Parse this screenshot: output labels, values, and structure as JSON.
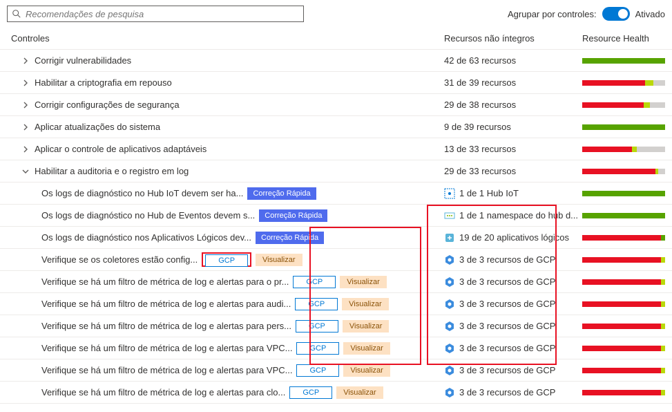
{
  "search": {
    "placeholder": "Recomendações de pesquisa"
  },
  "groupBy": {
    "label": "Agrupar por controles:",
    "state": "Ativado"
  },
  "columns": {
    "controls": "Controles",
    "unhealthy": "Recursos não íntegros",
    "health": "Resource Health"
  },
  "badges": {
    "quickfix": "Correção Rápida",
    "gcp": "GCP",
    "preview": "Visualizar"
  },
  "controls": [
    {
      "title": "Corrigir vulnerabilidades",
      "resources": "42 de 63 recursos",
      "health": [
        [
          "green",
          100
        ]
      ]
    },
    {
      "title": "Habilitar a criptografia em repouso",
      "resources": "31 de 39 recursos",
      "health": [
        [
          "red",
          76
        ],
        [
          "lime",
          10
        ],
        [
          "gray",
          14
        ]
      ]
    },
    {
      "title": "Corrigir configurações de segurança",
      "resources": "29 de 38 recursos",
      "health": [
        [
          "red",
          74
        ],
        [
          "lime",
          8
        ],
        [
          "gray",
          18
        ]
      ]
    },
    {
      "title": "Aplicar atualizações do sistema",
      "resources": "9 de 39 recursos",
      "health": [
        [
          "green",
          100
        ]
      ]
    },
    {
      "title": "Aplicar o controle de aplicativos adaptáveis",
      "resources": "13 de 33 recursos",
      "health": [
        [
          "red",
          60
        ],
        [
          "lime",
          6
        ],
        [
          "gray",
          34
        ]
      ]
    },
    {
      "title": "Habilitar a auditoria e o registro em log",
      "resources": "29 de 33 recursos",
      "health": [
        [
          "red",
          88
        ],
        [
          "lime",
          4
        ],
        [
          "gray",
          8
        ]
      ],
      "expanded": true
    }
  ],
  "children": [
    {
      "title": "Os logs de diagnóstico no Hub IoT devem ser ha...",
      "quickfix": true,
      "resIcon": "iot",
      "resources": "1 de 1 Hub IoT",
      "health": [
        [
          "green",
          100
        ]
      ]
    },
    {
      "title": "Os logs de diagnóstico no Hub de Eventos devem s...",
      "quickfix": true,
      "resIcon": "eventhub",
      "resources": "1 de 1 namespace do hub d...",
      "health": [
        [
          "green",
          100
        ]
      ]
    },
    {
      "title": "Os logs de diagnóstico nos Aplicativos Lógicos dev...",
      "quickfix": true,
      "resIcon": "logicapp",
      "resources": "19 de 20 aplicativos lógicos",
      "health": [
        [
          "red",
          95
        ],
        [
          "green",
          5
        ]
      ]
    },
    {
      "title": "Verifique se os coletores estão config...",
      "gcp": true,
      "preview": true,
      "resIcon": "gcp",
      "resources": "3 de 3 recursos de GCP",
      "health": [
        [
          "red",
          95
        ],
        [
          "lime",
          5
        ]
      ],
      "gcpBoxLeft": true
    },
    {
      "title": "Verifique se há um filtro de métrica de log e alertas para o pr...",
      "gcp": true,
      "preview": true,
      "resIcon": "gcp",
      "resources": "3 de 3 recursos de GCP",
      "health": [
        [
          "red",
          95
        ],
        [
          "lime",
          5
        ]
      ]
    },
    {
      "title": "Verifique se há um filtro de métrica de log e alertas para audi...",
      "gcp": true,
      "preview": true,
      "resIcon": "gcp",
      "resources": "3 de 3 recursos de GCP",
      "health": [
        [
          "red",
          95
        ],
        [
          "lime",
          5
        ]
      ]
    },
    {
      "title": "Verifique se há um filtro de métrica de log e alertas para pers...",
      "gcp": true,
      "preview": true,
      "resIcon": "gcp",
      "resources": "3 de 3 recursos de GCP",
      "health": [
        [
          "red",
          95
        ],
        [
          "lime",
          5
        ]
      ]
    },
    {
      "title": "Verifique se há um filtro de métrica de log e alertas para VPC...",
      "gcp": true,
      "preview": true,
      "resIcon": "gcp",
      "resources": "3 de 3 recursos de GCP",
      "health": [
        [
          "red",
          95
        ],
        [
          "lime",
          5
        ]
      ]
    },
    {
      "title": "Verifique se há um filtro de métrica de log e alertas para VPC...",
      "gcp": true,
      "preview": true,
      "resIcon": "gcp",
      "resources": "3 de 3 recursos de GCP",
      "health": [
        [
          "red",
          95
        ],
        [
          "lime",
          5
        ]
      ]
    },
    {
      "title": "Verifique se há um filtro de métrica de log e alertas para clo...",
      "gcp": true,
      "preview": true,
      "resIcon": "gcp",
      "resources": "3 de 3 recursos de GCP",
      "health": [
        [
          "red",
          95
        ],
        [
          "lime",
          5
        ]
      ]
    }
  ]
}
